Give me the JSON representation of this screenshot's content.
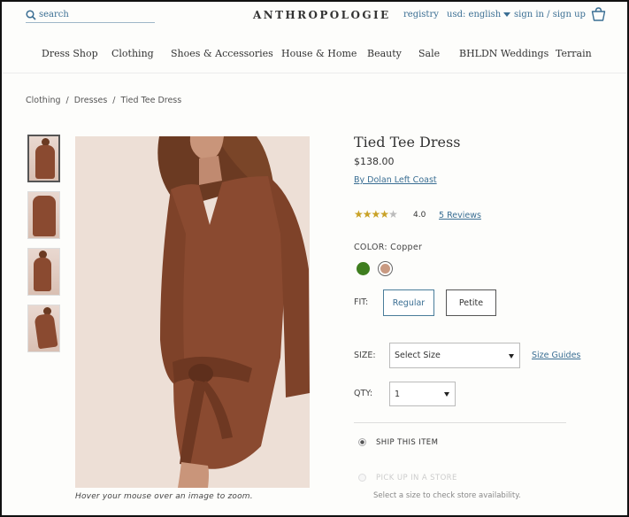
{
  "header": {
    "search_placeholder": "search",
    "logo": "ANTHROPOLOGIE",
    "registry": "registry",
    "currency": "usd: english",
    "signin": "sign in / sign up"
  },
  "nav": [
    "Dress Shop",
    "Clothing",
    "Shoes & Accessories",
    "House & Home",
    "Beauty",
    "Sale",
    "BHLDN Weddings",
    "Terrain"
  ],
  "breadcrumb": [
    "Clothing",
    "Dresses",
    "Tied Tee Dress"
  ],
  "gallery": {
    "caption": "Hover your mouse over an image to zoom."
  },
  "product": {
    "title": "Tied Tee Dress",
    "price": "$138.00",
    "brand": "By Dolan Left Coast",
    "rating_value": "4.0",
    "rating_stars": 4,
    "reviews": "5 Reviews",
    "color_label": "COLOR: Copper",
    "colors": [
      "#3f7e1f",
      "#c99a82"
    ],
    "fit_label": "FIT:",
    "fit_options": [
      "Regular",
      "Petite"
    ],
    "size_label": "SIZE:",
    "size_value": "Select Size",
    "size_guides": "Size Guides",
    "qty_label": "QTY:",
    "qty_value": "1",
    "ship_label": "SHIP THIS ITEM",
    "pickup_label": "PICK UP IN A STORE",
    "pickup_note": "Select a size to check store availability."
  },
  "colors": {
    "link": "#3a6e93",
    "dress": "#8a4a30"
  }
}
